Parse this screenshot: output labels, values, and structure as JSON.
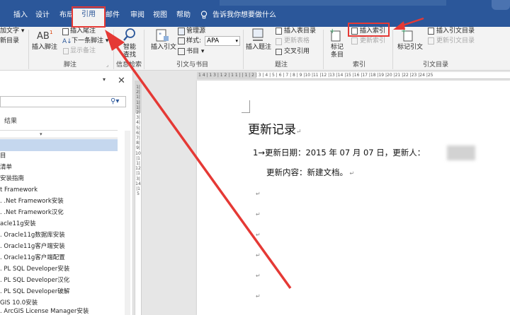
{
  "menu": {
    "items": [
      "插入",
      "设计",
      "布局",
      "引用",
      "邮件",
      "审阅",
      "视图",
      "帮助"
    ],
    "active_index": 3,
    "tell_me": "告诉我你想要做什么"
  },
  "ribbon": {
    "toc": {
      "line1": "目录",
      "line2": "目录",
      "add_text": "加文字 ▾",
      "update_table": "新目录"
    },
    "footnotes": {
      "insert_footnote": "插入脚注",
      "insert_endnote": "插入尾注",
      "next_footnote": "下一条脚注 ▾",
      "show_notes": "显示备注",
      "group": "脚注"
    },
    "research": {
      "smart": "智能",
      "lookup": "查找",
      "group": "信息检索"
    },
    "citations": {
      "insert_citation_1": "插入引文",
      "manage_sources": "管理源",
      "style_label": "样式:",
      "style_value": "APA",
      "bibliography": "书目 ▾",
      "group": "引文与书目"
    },
    "captions": {
      "insert_caption": "插入题注",
      "insert_table_of_figures": "插入表目录",
      "update_table": "更新表格",
      "cross_reference": "交叉引用",
      "group": "题注"
    },
    "index": {
      "mark_entry_1": "标记",
      "mark_entry_2": "条目",
      "insert_index": "插入索引",
      "update_index": "更新索引",
      "group": "索引"
    },
    "toa": {
      "mark_citation": "标记引文",
      "insert_toa": "插入引文目录",
      "update_toa": "更新引文目录",
      "group": "引文目录"
    }
  },
  "nav": {
    "tab_results": "结果",
    "items": [
      "清单",
      "安装指南",
      "t Framework",
      ". .Net Framework安装",
      ". .Net Framework汉化",
      "acle11g安装",
      ". Oracle11g数据库安装",
      ". Oracle11g客户端安装",
      ". Oracle11g客户端配置",
      ". PL SQL Developer安装",
      ". PL SQL Developer汉化",
      ". PL SQL Developer破解",
      "GIS 10.0安装",
      ". ArcGIS License Manager安装"
    ]
  },
  "ruler": {
    "horizontal": "1 4 | 1 3 | 1 2 | 1 1 |   | 1 | 2 | 3 | 4 | 5 | 6 | 7 | 8 | 9 |10 |11 |12 |13 |14 |15 |16 |17 |18 |19 |20 |21 |22 |23 |24 |25",
    "vertical": "1|2|1|1|1|2|3|4|5|6|7|8|9|10|11|12|13|14|15"
  },
  "document": {
    "heading": "更新记录",
    "line1": "1→更新日期：2015 年 07 月 07 日，更新人：",
    "line2": "更新内容：新建文档。"
  }
}
